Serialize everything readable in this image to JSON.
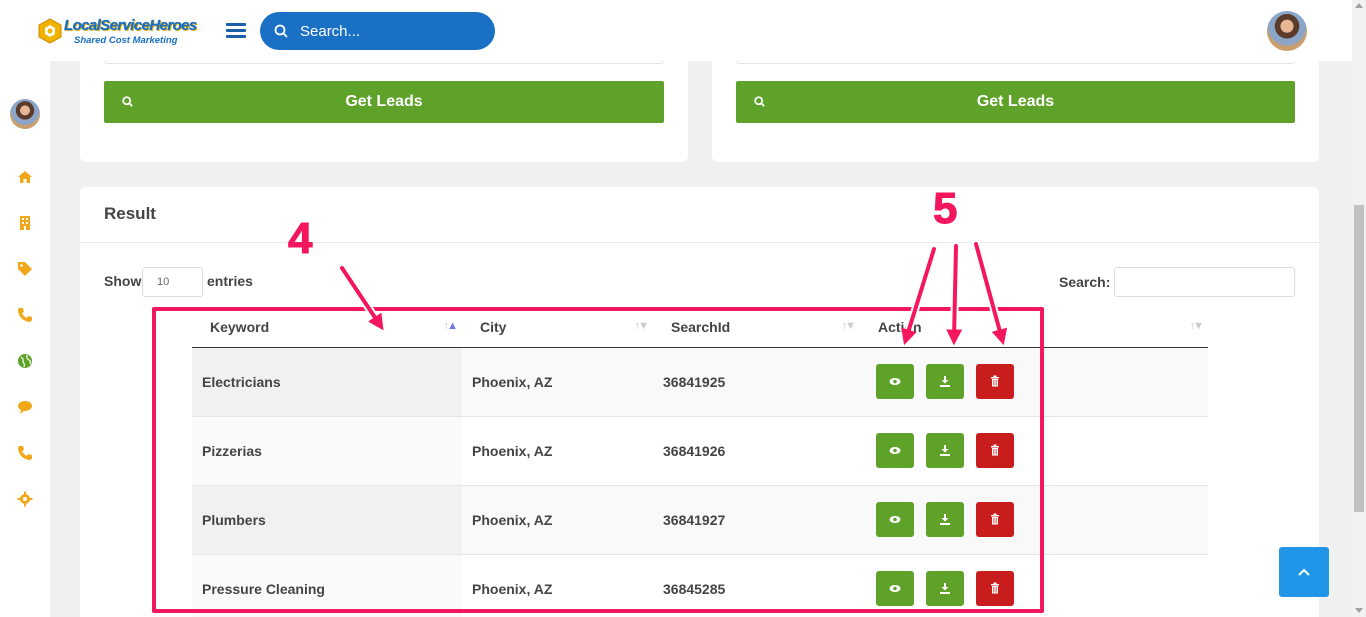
{
  "brand": {
    "name": "LocalServiceHeroes",
    "tagline": "Shared Cost Marketing"
  },
  "header": {
    "search_placeholder": "Search..."
  },
  "sidebar": {
    "icons": [
      "home-icon",
      "building-icon",
      "tag-icon",
      "phone-icon",
      "globe-icon",
      "chat-icon",
      "phone-icon",
      "gear-icon"
    ]
  },
  "cards": {
    "left_button": "Get Leads",
    "right_button": "Get Leads"
  },
  "result": {
    "title": "Result",
    "show_label": "Show",
    "page_size": "10",
    "entries_label": "entries",
    "search_label": "Search:"
  },
  "table": {
    "columns": [
      "Keyword",
      "City",
      "SearchId",
      "Action"
    ],
    "rows": [
      {
        "keyword": "Electricians",
        "city": "Phoenix, AZ",
        "search_id": "36841925"
      },
      {
        "keyword": "Pizzerias",
        "city": "Phoenix, AZ",
        "search_id": "36841926"
      },
      {
        "keyword": "Plumbers",
        "city": "Phoenix, AZ",
        "search_id": "36841927"
      },
      {
        "keyword": "Pressure Cleaning",
        "city": "Phoenix, AZ",
        "search_id": "36845285"
      }
    ]
  },
  "annotations": {
    "label_4": "4",
    "label_5": "5"
  },
  "colors": {
    "accent_blue": "#1970c4",
    "action_green": "#5fa22a",
    "action_red": "#c91c1c",
    "annotation_pink": "#f4175d",
    "sidebar_icon_orange": "#f0a81a",
    "globe_green": "#5fa22a"
  }
}
